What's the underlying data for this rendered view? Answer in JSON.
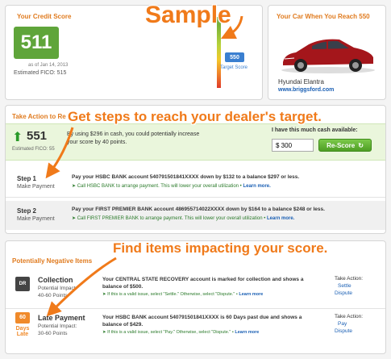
{
  "callouts": {
    "sample": "Sample",
    "steps": "Get steps to reach your dealer's target.",
    "items": "Find items impacting your score."
  },
  "credit": {
    "title": "Your Credit Score",
    "score": "511",
    "as_of": "as of Jan 14, 2013",
    "estimated_fico": "Estimated FICO: 515",
    "target_value": "550",
    "target_label": "Target Score"
  },
  "car": {
    "title": "Your Car When You Reach 550",
    "model": "Hyundai Elantra",
    "link": "www.briggsford.com"
  },
  "action": {
    "title": "Take Action to Re",
    "score": "551",
    "estimated_fico": "Estimated FICO: 55",
    "message": "By using $296 in cash, you could potentially increase your score by 40 points.",
    "cash_label": "I have this much cash available:",
    "cash_value": "$ 300",
    "rescore_label": "Re-Score",
    "steps": [
      {
        "title": "Step 1",
        "subtitle": "Make Payment",
        "text": "Pay your HSBC BANK account 540791501841XXXX down by $132 to a balance $297 or less.",
        "hint": "Call HSBC BANK to arrange payment. This will lower your overall utilization •",
        "learn": "Learn more."
      },
      {
        "title": "Step 2",
        "subtitle": "Make Payment",
        "text": "Pay your FIRST PREMIER BANK account 486955714022XXXX down by $164 to a balance $248 or less.",
        "hint": "Call FIRST PREMIER BANK to arrange payment. This will lower your overall utilization •",
        "learn": "Learn more."
      }
    ]
  },
  "negative": {
    "title": "Potentially Negative Items",
    "items": [
      {
        "badge": "DR",
        "title": "Collection",
        "impact_label": "Potential Impact:",
        "impact": "40-60 Points",
        "text": "Your CENTRAL STATE RECOVERY account is marked for collection and shows a balance of $500.",
        "hint": "If this is a valid issue, select \"Settle.\" Otherwise, select \"Dispute.\" •",
        "learn": "Learn more",
        "take_action": "Take Action:",
        "action1": "Settle",
        "action2": "Dispute"
      },
      {
        "badge_top": "60",
        "badge_mid": "Days",
        "badge_bot": "Late",
        "title": "Late Payment",
        "impact_label": "Potential Impact:",
        "impact": "30-60 Points",
        "text": "Your HSBC BANK account 540791501841XXXX is 60 Days past due and shows a balance of $429.",
        "hint": "If this is a valid issue, select \"Pay.\" Otherwise, select \"Dispute.\" •",
        "learn": "Learn more",
        "take_action": "Take Action:",
        "action1": "Pay",
        "action2": "Dispute"
      }
    ]
  },
  "colors": {
    "accent": "#e07b1f",
    "score_green": "#5fa53a",
    "target_blue": "#3a7fd0",
    "link_blue": "#1a5fb4"
  }
}
